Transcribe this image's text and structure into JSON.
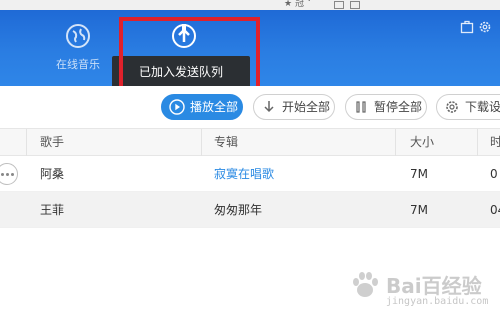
{
  "browser": {
    "star_icon": "star-icon",
    "bookmark_label": "冠",
    "caret": "˅"
  },
  "nav": {
    "tabs": [
      {
        "label": "在线音乐",
        "icon": "globe-icon"
      },
      {
        "label": "",
        "icon": "upload-arrow-icon"
      }
    ]
  },
  "toast": {
    "message": "已加入发送队列"
  },
  "toolbar": {
    "play_all": "播放全部",
    "start_all": "开始全部",
    "pause_all": "暂停全部",
    "download_settings": "下载设"
  },
  "table": {
    "columns": [
      "歌手",
      "专辑",
      "大小",
      "时"
    ],
    "rows": [
      {
        "artist": "阿桑",
        "album": "寂寞在唱歌",
        "size": "7M",
        "time": "0"
      },
      {
        "artist": "王菲",
        "album": "匆匆那年",
        "size": "7M",
        "time": "04"
      }
    ]
  },
  "watermark": {
    "text": "Bai百经验",
    "sub": "jingyan.baidu.com"
  },
  "colors": {
    "header_blue": "#2a7de2",
    "accent_blue": "#2a8ae3",
    "highlight_red": "#e0212b",
    "toast_bg": "#2b2f33"
  }
}
